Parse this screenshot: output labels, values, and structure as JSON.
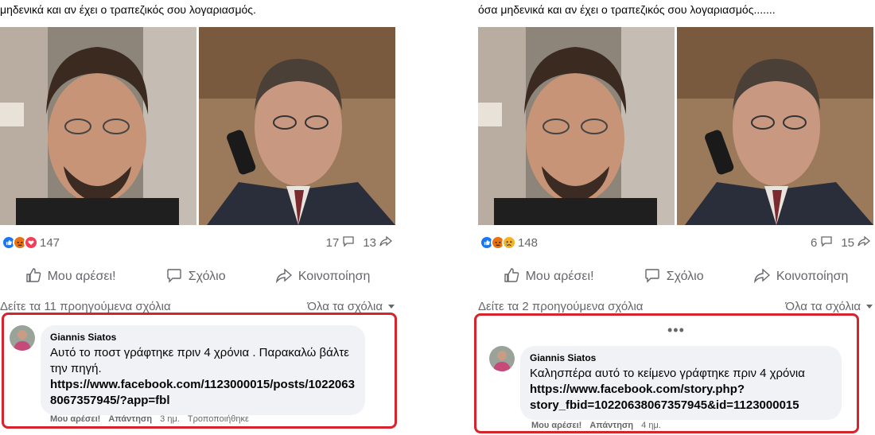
{
  "left_post": {
    "text": "μηδενικά και αν έχει ο τραπεζικός σου λογαριασμός.",
    "reaction_count": "147",
    "comment_count": "17",
    "share_count": "13",
    "actions": {
      "like": "Μου αρέσει!",
      "comment": "Σχόλιο",
      "share": "Κοινοποίηση"
    },
    "prev_comments": "Δείτε τα 11 προηγούμενα σχόλια",
    "filter": "Όλα τα σχόλια",
    "comment": {
      "author": "Giannis Siatos",
      "text": "Αυτό το ποστ γράφτηκε πριν 4 χρόνια . Παρακαλώ βάλτε την πηγή.",
      "link_line1": "https://www.facebook.com/1123000015/posts/1022063",
      "link_line2": "8067357945/?app=fbl",
      "like": "Μου αρέσει!",
      "reply": "Απάντηση",
      "time": "3 ημ.",
      "edited": "Τροποποιήθηκε"
    }
  },
  "right_post": {
    "text": "όσα μηδενικά και αν έχει ο τραπεζικός σου λογαριασμός.......",
    "reaction_count": "148",
    "comment_count": "6",
    "share_count": "15",
    "actions": {
      "like": "Μου αρέσει!",
      "comment": "Σχόλιο",
      "share": "Κοινοποίηση"
    },
    "prev_comments": "Δείτε τα 2 προηγούμενα σχόλια",
    "filter": "Όλα τα σχόλια",
    "more": "•••",
    "comment": {
      "author": "Giannis Siatos",
      "text": "Καλησπέρα αυτό το κείμενο γράφτηκε πριν 4 χρόνια",
      "link_line1": "https://www.facebook.com/story.php?",
      "link_line2": "story_fbid=10220638067357945&id=1123000015",
      "like": "Μου αρέσει!",
      "reply": "Απάντηση",
      "time": "4 ημ."
    }
  },
  "colors": {
    "highlight": "#d7232b",
    "like_blue": "#1877f2",
    "angry": "#e9710f",
    "love": "#f33e58"
  }
}
